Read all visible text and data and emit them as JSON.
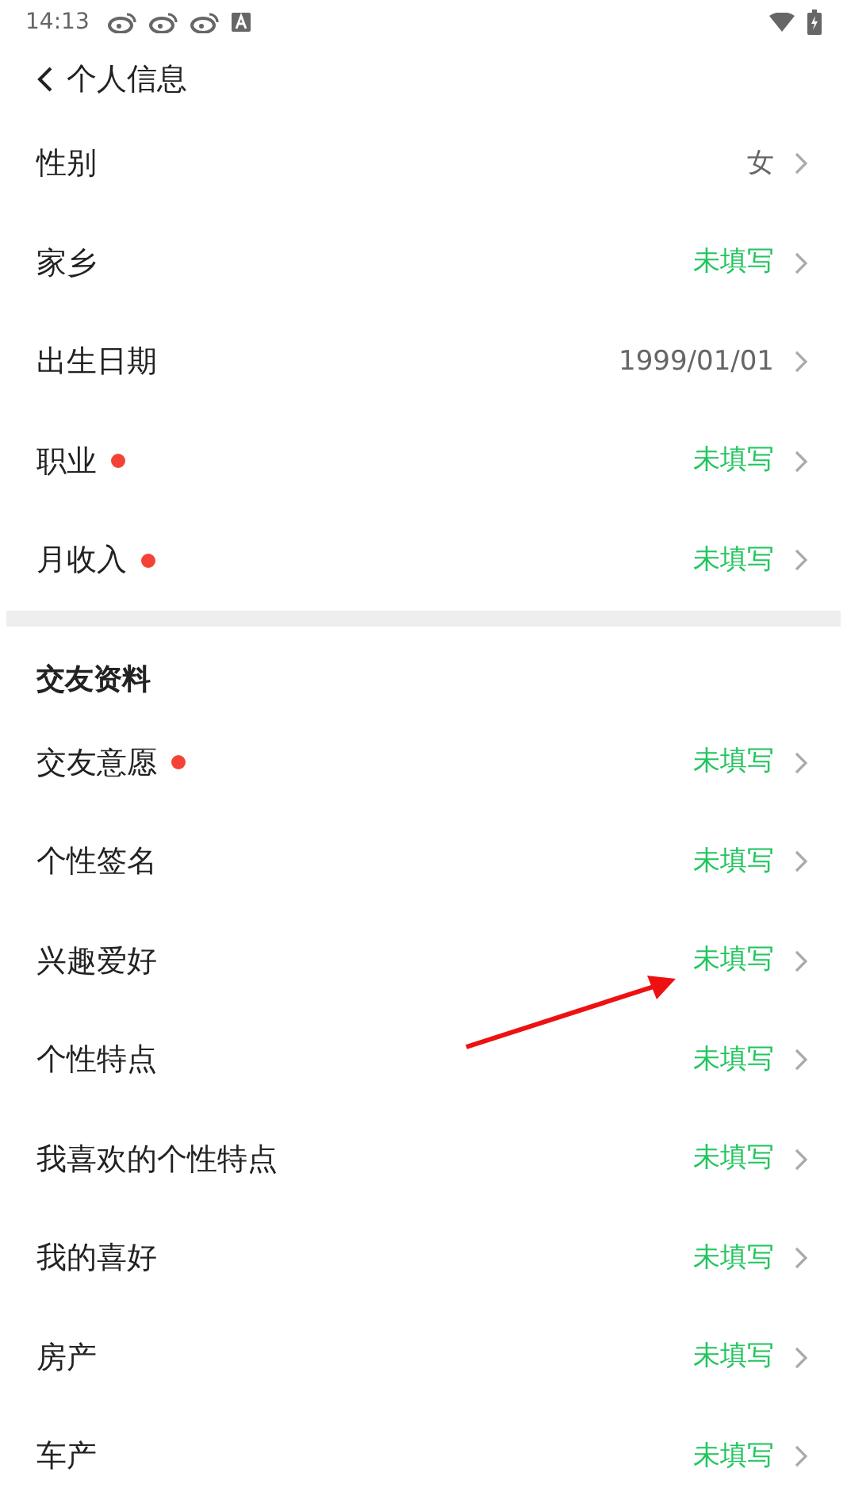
{
  "status_bar": {
    "time": "14:13"
  },
  "header": {
    "title": "个人信息"
  },
  "basic_rows": [
    {
      "label": "性别",
      "dot": false,
      "value": "女",
      "filled": true
    },
    {
      "label": "家乡",
      "dot": false,
      "value": "未填写",
      "filled": false
    },
    {
      "label": "出生日期",
      "dot": false,
      "value": "1999/01/01",
      "filled": true
    },
    {
      "label": "职业",
      "dot": true,
      "value": "未填写",
      "filled": false
    },
    {
      "label": "月收入",
      "dot": true,
      "value": "未填写",
      "filled": false
    }
  ],
  "section": {
    "title": "交友资料",
    "rows": [
      {
        "label": "交友意愿",
        "dot": true,
        "value": "未填写",
        "filled": false
      },
      {
        "label": "个性签名",
        "dot": false,
        "value": "未填写",
        "filled": false
      },
      {
        "label": "兴趣爱好",
        "dot": false,
        "value": "未填写",
        "filled": false
      },
      {
        "label": "个性特点",
        "dot": false,
        "value": "未填写",
        "filled": false
      },
      {
        "label": "我喜欢的个性特点",
        "dot": false,
        "value": "未填写",
        "filled": false
      },
      {
        "label": "我的喜好",
        "dot": false,
        "value": "未填写",
        "filled": false
      },
      {
        "label": "房产",
        "dot": false,
        "value": "未填写",
        "filled": false
      },
      {
        "label": "车产",
        "dot": false,
        "value": "未填写",
        "filled": false
      }
    ]
  }
}
